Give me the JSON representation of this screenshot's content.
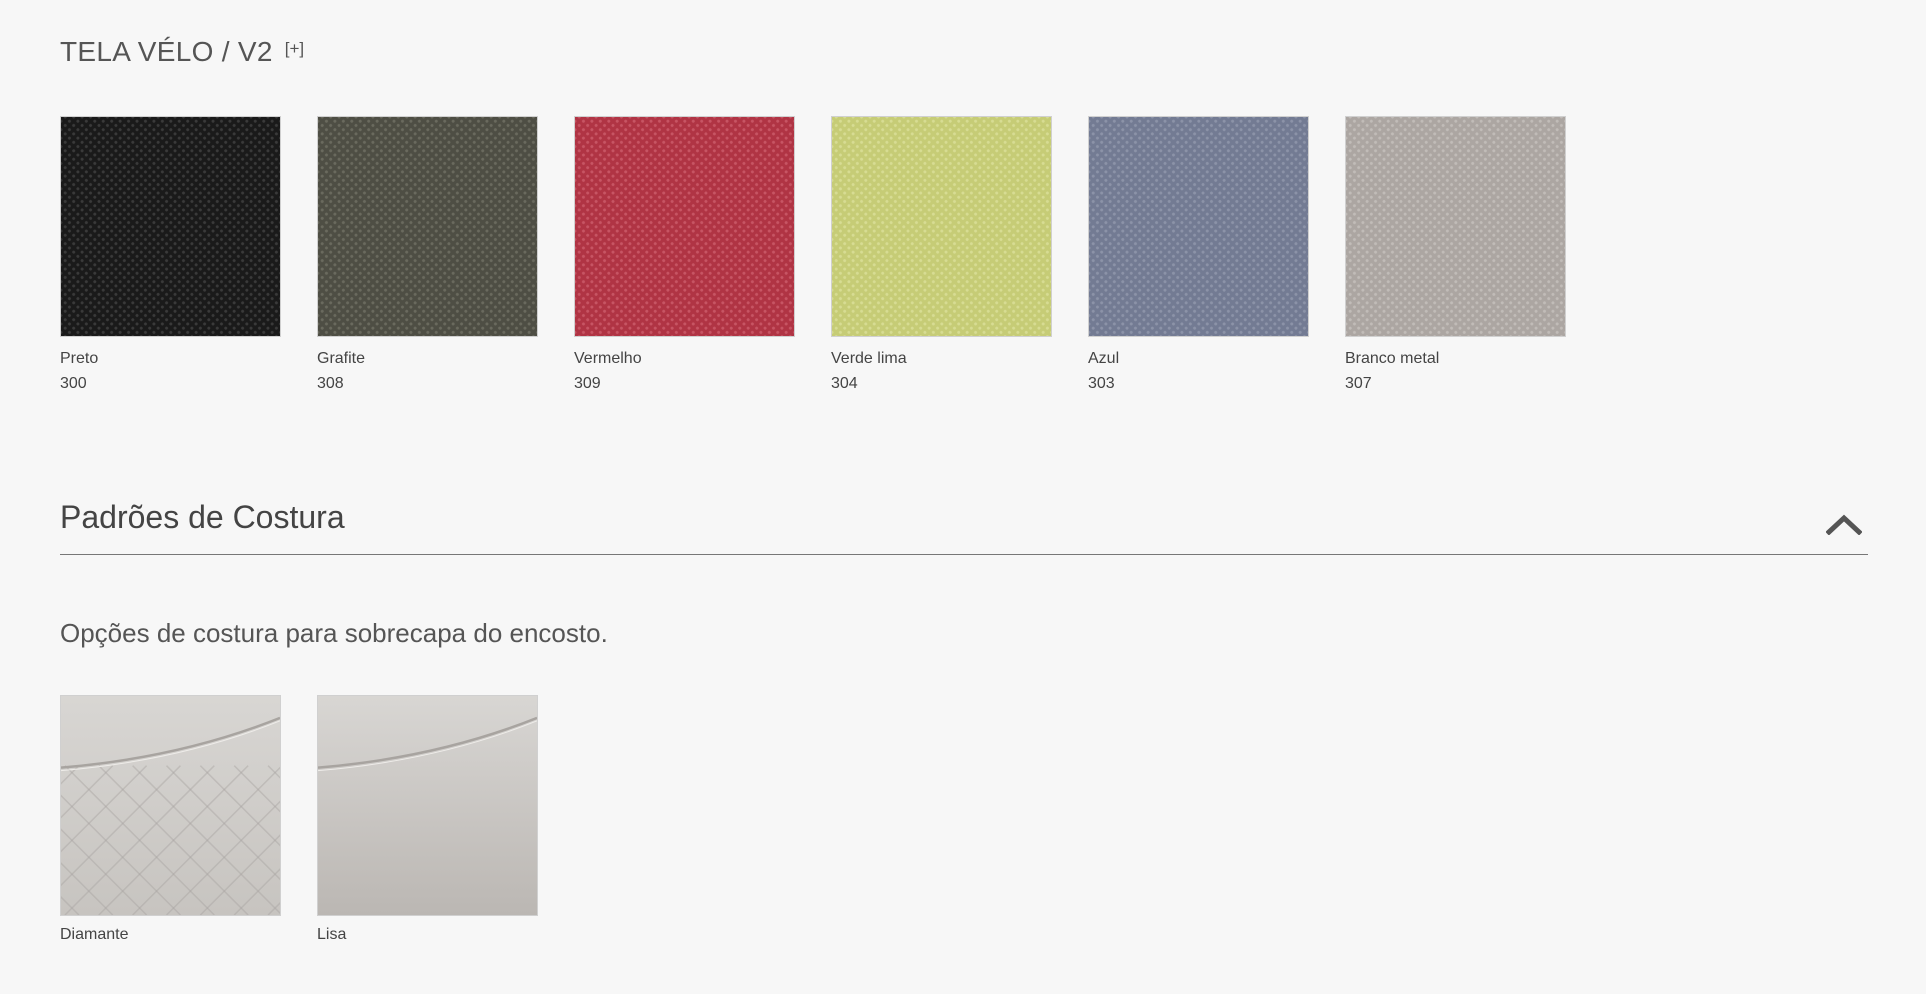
{
  "fabric_section": {
    "title": "TELA VÉLO / V2",
    "expand_label": "[+]",
    "swatches": [
      {
        "name": "Preto",
        "code": "300",
        "color": "#1a1a1a",
        "thread": "#3a3a3a"
      },
      {
        "name": "Grafite",
        "code": "308",
        "color": "#4e4e44",
        "thread": "#6a6a5e"
      },
      {
        "name": "Vermelho",
        "code": "309",
        "color": "#b03444",
        "thread": "#c75564"
      },
      {
        "name": "Verde lima",
        "code": "304",
        "color": "#c6cc76",
        "thread": "#d7dc93"
      },
      {
        "name": "Azul",
        "code": "303",
        "color": "#737b93",
        "thread": "#8c93a8"
      },
      {
        "name": "Branco metal",
        "code": "307",
        "color": "#aca6a2",
        "thread": "#c1bcb8"
      }
    ]
  },
  "stitch_section": {
    "title": "Padrões de Costura",
    "collapse_icon": "chevron-up-icon",
    "description": "Opções de costura para sobrecapa do encosto.",
    "swatches": [
      {
        "name": "Diamante",
        "color": "#c7c4c0"
      },
      {
        "name": "Lisa",
        "color": "#bbb7b3"
      }
    ]
  }
}
